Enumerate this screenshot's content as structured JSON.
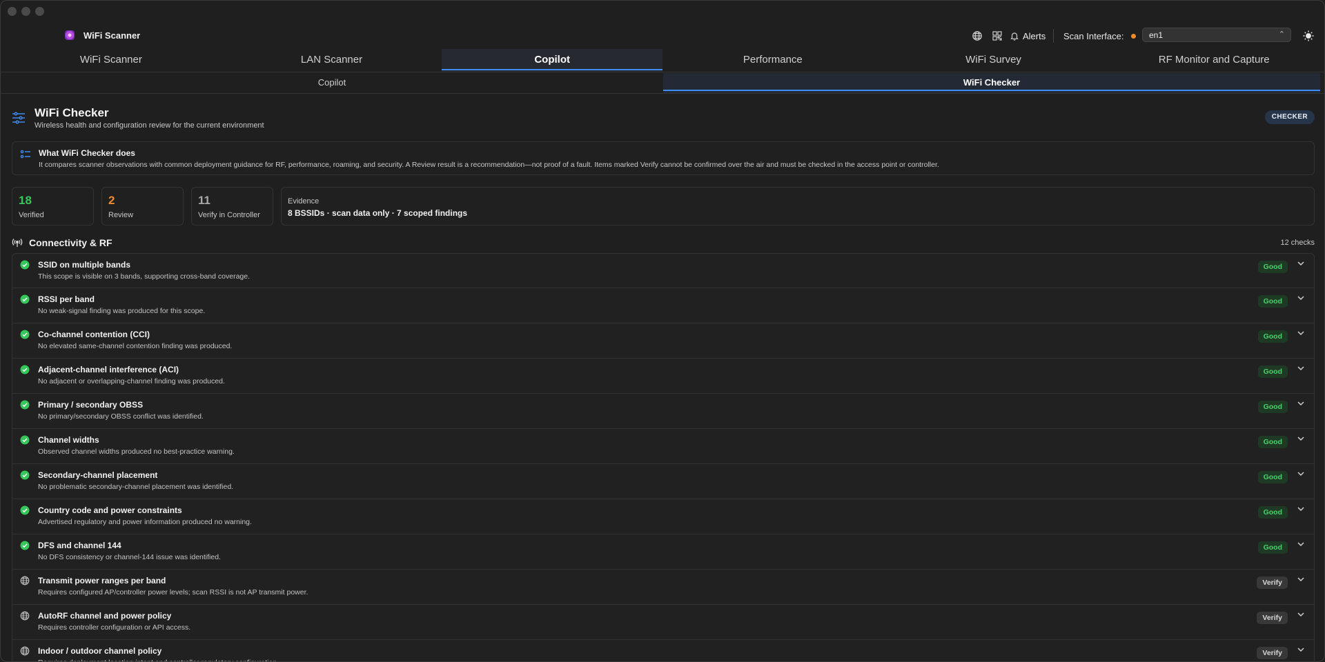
{
  "app": {
    "title": "WiFi Scanner"
  },
  "header": {
    "alerts_label": "Alerts",
    "scan_interface_label": "Scan Interface:",
    "scan_interface_value": "en1",
    "status_color": "#f28a28"
  },
  "main_tabs": [
    {
      "label": "WiFi Scanner",
      "active": false
    },
    {
      "label": "LAN Scanner",
      "active": false
    },
    {
      "label": "Copilot",
      "active": true
    },
    {
      "label": "Performance",
      "active": false
    },
    {
      "label": "WiFi Survey",
      "active": false
    },
    {
      "label": "RF Monitor and Capture",
      "active": false
    }
  ],
  "sub_tabs": [
    {
      "label": "Copilot",
      "active": false
    },
    {
      "label": "WiFi Checker",
      "active": true
    }
  ],
  "checker": {
    "title": "WiFi Checker",
    "subtitle": "Wireless health and configuration review for the current environment",
    "badge": "CHECKER"
  },
  "info": {
    "title": "What WiFi Checker does",
    "text": "It compares scanner observations with common deployment guidance for RF, performance, roaming, and security. A Review result is a recommendation—not proof of a fault. Items marked Verify cannot be confirmed over the air and must be checked in the access point or controller."
  },
  "stats": {
    "verified": {
      "value": "18",
      "label": "Verified"
    },
    "review": {
      "value": "2",
      "label": "Review"
    },
    "verify_controller": {
      "value": "11",
      "label": "Verify in Controller"
    },
    "evidence": {
      "label": "Evidence",
      "text": "8 BSSIDs · scan data only · 7 scoped findings"
    }
  },
  "section": {
    "title": "Connectivity & RF",
    "count": "12 checks",
    "checks": [
      {
        "title": "SSID on multiple bands",
        "desc": "This scope is visible on 3 bands, supporting cross-band coverage.",
        "status": "Good",
        "kind": "good"
      },
      {
        "title": "RSSI per band",
        "desc": "No weak-signal finding was produced for this scope.",
        "status": "Good",
        "kind": "good"
      },
      {
        "title": "Co-channel contention (CCI)",
        "desc": "No elevated same-channel contention finding was produced.",
        "status": "Good",
        "kind": "good"
      },
      {
        "title": "Adjacent-channel interference (ACI)",
        "desc": "No adjacent or overlapping-channel finding was produced.",
        "status": "Good",
        "kind": "good"
      },
      {
        "title": "Primary / secondary OBSS",
        "desc": "No primary/secondary OBSS conflict was identified.",
        "status": "Good",
        "kind": "good"
      },
      {
        "title": "Channel widths",
        "desc": "Observed channel widths produced no best-practice warning.",
        "status": "Good",
        "kind": "good"
      },
      {
        "title": "Secondary-channel placement",
        "desc": "No problematic secondary-channel placement was identified.",
        "status": "Good",
        "kind": "good"
      },
      {
        "title": "Country code and power constraints",
        "desc": "Advertised regulatory and power information produced no warning.",
        "status": "Good",
        "kind": "good"
      },
      {
        "title": "DFS and channel 144",
        "desc": "No DFS consistency or channel-144 issue was identified.",
        "status": "Good",
        "kind": "good"
      },
      {
        "title": "Transmit power ranges per band",
        "desc": "Requires configured AP/controller power levels; scan RSSI is not AP transmit power.",
        "status": "Verify",
        "kind": "verify"
      },
      {
        "title": "AutoRF channel and power policy",
        "desc": "Requires controller configuration or API access.",
        "status": "Verify",
        "kind": "verify"
      },
      {
        "title": "Indoor / outdoor channel policy",
        "desc": "Requires deployment location intent and controller regulatory configuration.",
        "status": "Verify",
        "kind": "verify"
      }
    ]
  },
  "colors": {
    "accent": "#3b8cf5",
    "good": "#36c75a",
    "review": "#f08a2e"
  }
}
